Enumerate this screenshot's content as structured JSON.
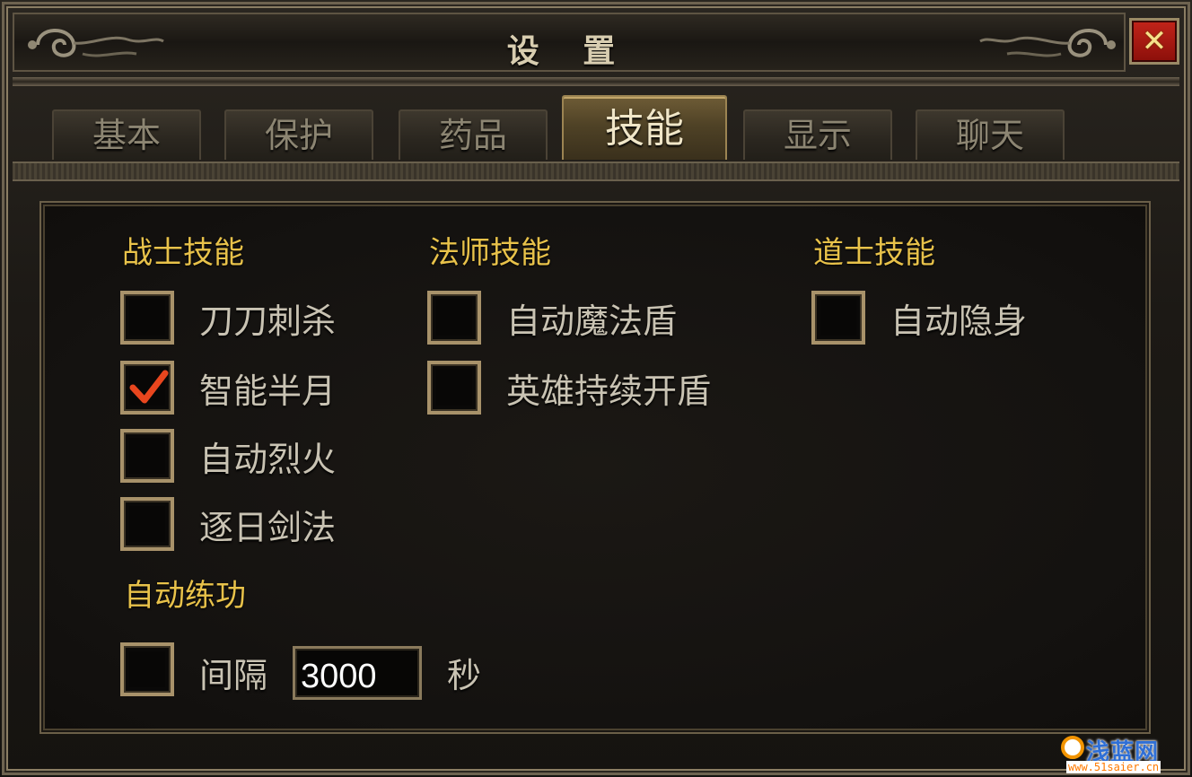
{
  "window": {
    "title": "设 置",
    "close_glyph": "✕"
  },
  "tabs": [
    {
      "label": "基本",
      "active": false
    },
    {
      "label": "保护",
      "active": false
    },
    {
      "label": "药品",
      "active": false
    },
    {
      "label": "技能",
      "active": true
    },
    {
      "label": "显示",
      "active": false
    },
    {
      "label": "聊天",
      "active": false
    }
  ],
  "sections": {
    "warrior": {
      "title": "战士技能",
      "items": [
        {
          "label": "刀刀刺杀",
          "checked": false
        },
        {
          "label": "智能半月",
          "checked": true
        },
        {
          "label": "自动烈火",
          "checked": false
        },
        {
          "label": "逐日剑法",
          "checked": false
        }
      ]
    },
    "mage": {
      "title": "法师技能",
      "items": [
        {
          "label": "自动魔法盾",
          "checked": false
        },
        {
          "label": "英雄持续开盾",
          "checked": false
        }
      ]
    },
    "taoist": {
      "title": "道士技能",
      "items": [
        {
          "label": "自动隐身",
          "checked": false
        }
      ]
    },
    "auto_practice": {
      "title": "自动练功",
      "checked": false,
      "interval_label": "间隔",
      "interval_value": "3000",
      "unit_label": "秒"
    }
  },
  "watermark": {
    "main": "浅蓝网",
    "sub": "www.51saier.cn"
  },
  "colors": {
    "section_title": "#e8c24a",
    "check_mark": "#e8461e",
    "close_button": "#b3201a"
  },
  "icons": {
    "close": "close-icon",
    "check": "checkmark-icon",
    "ornament": "scroll-ornament-icon"
  }
}
